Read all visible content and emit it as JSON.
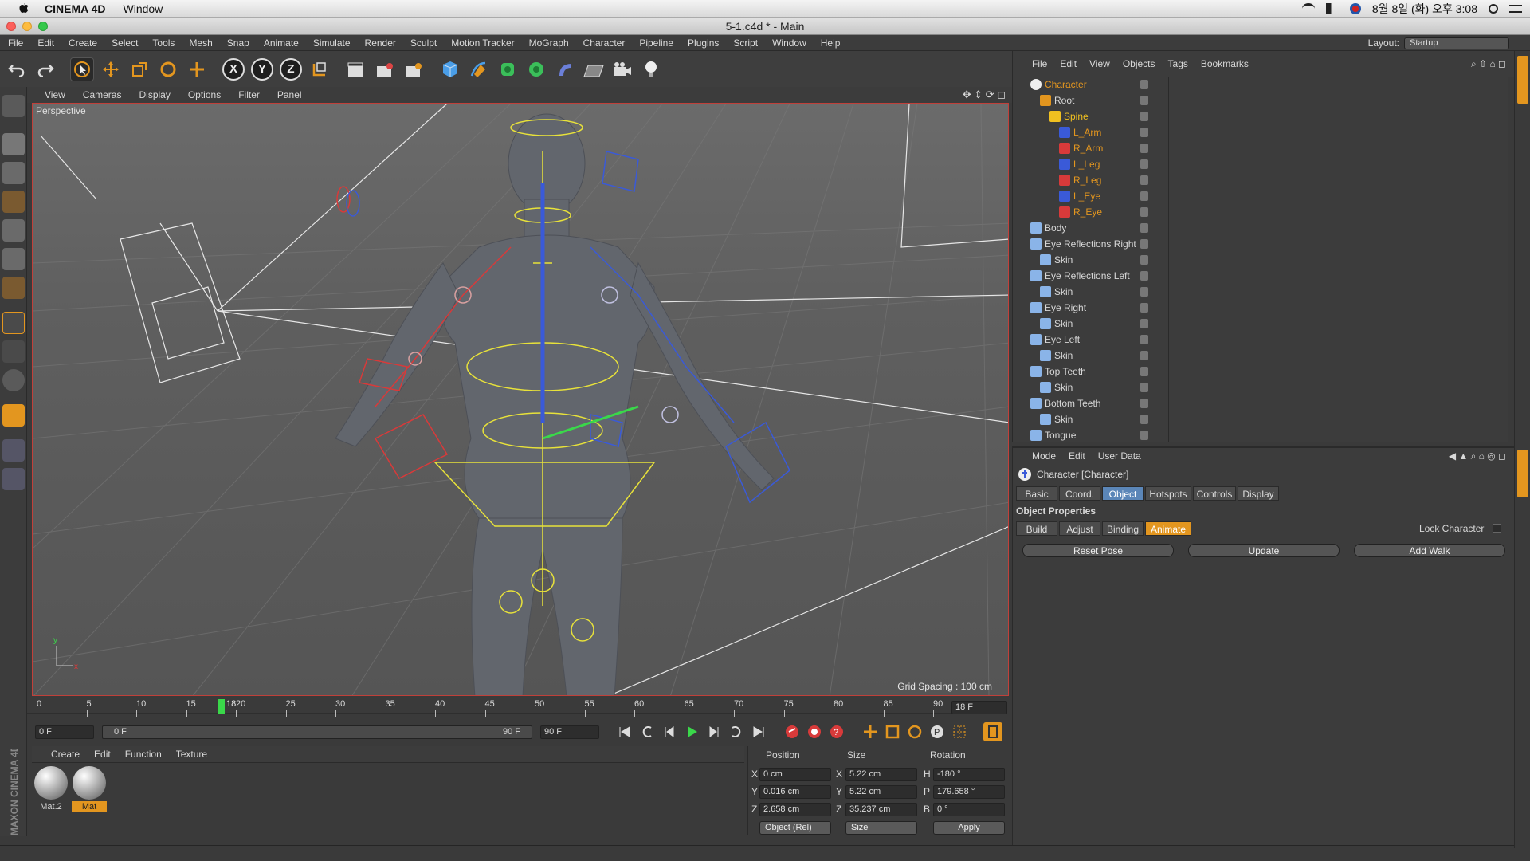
{
  "os_menubar": {
    "app_name": "CINEMA 4D",
    "menus": [
      "Window"
    ],
    "clock": "8월 8일 (화) 오후 3:08"
  },
  "window": {
    "title": "5-1.c4d * - Main"
  },
  "menu": {
    "items": [
      "File",
      "Edit",
      "Create",
      "Select",
      "Tools",
      "Mesh",
      "Snap",
      "Animate",
      "Simulate",
      "Render",
      "Sculpt",
      "Motion Tracker",
      "MoGraph",
      "Character",
      "Pipeline",
      "Plugins",
      "Script",
      "Window",
      "Help"
    ],
    "layout_label": "Layout:",
    "layout_value": "Startup"
  },
  "toolbar": {
    "axis_x": "X",
    "axis_y": "Y",
    "axis_z": "Z"
  },
  "viewport": {
    "menu": [
      "View",
      "Cameras",
      "Display",
      "Options",
      "Filter",
      "Panel"
    ],
    "label": "Perspective",
    "grid_spacing": "Grid Spacing : 100 cm"
  },
  "timeline": {
    "ticks": [
      "0",
      "5",
      "10",
      "15",
      "20",
      "25",
      "30",
      "35",
      "40",
      "45",
      "50",
      "55",
      "60",
      "65",
      "70",
      "75",
      "80",
      "85",
      "90"
    ],
    "current_frame_label": "18",
    "current_frame_field": "18 F",
    "start_field": "0 F",
    "range_start": "0 F",
    "range_end": "90 F",
    "end_field": "90 F"
  },
  "material_manager": {
    "menu": [
      "Create",
      "Edit",
      "Function",
      "Texture"
    ],
    "materials": [
      {
        "name": "Mat.2"
      },
      {
        "name": "Mat"
      }
    ],
    "brand": "MAXON CINEMA 4D"
  },
  "coordinates": {
    "headers": [
      "Position",
      "Size",
      "Rotation"
    ],
    "rows": [
      {
        "axis": "X",
        "pos": "0 cm",
        "size_axis": "X",
        "size": "5.22 cm",
        "rot_axis": "H",
        "rot": "-180 °"
      },
      {
        "axis": "Y",
        "pos": "0.016 cm",
        "size_axis": "Y",
        "size": "5.22 cm",
        "rot_axis": "P",
        "rot": "179.658 °"
      },
      {
        "axis": "Z",
        "pos": "2.658 cm",
        "size_axis": "Z",
        "size": "35.237 cm",
        "rot_axis": "B",
        "rot": "0 °"
      }
    ],
    "mode": "Object (Rel)",
    "size_mode": "Size",
    "apply": "Apply"
  },
  "object_manager": {
    "menu": [
      "File",
      "Edit",
      "View",
      "Objects",
      "Tags",
      "Bookmarks"
    ],
    "objects": [
      {
        "name": "Character",
        "color": "#e3961f"
      },
      {
        "name": "Root",
        "color": "#d8d8d8"
      },
      {
        "name": "Spine",
        "color": "#f0c020"
      },
      {
        "name": "L_Arm",
        "color": "#e3961f"
      },
      {
        "name": "R_Arm",
        "color": "#e3961f"
      },
      {
        "name": "L_Leg",
        "color": "#e3961f"
      },
      {
        "name": "R_Leg",
        "color": "#e3961f"
      },
      {
        "name": "L_Eye",
        "color": "#e3961f"
      },
      {
        "name": "R_Eye",
        "color": "#e3961f"
      },
      {
        "name": "Body",
        "color": "#d8d8d8"
      },
      {
        "name": "Eye Reflections Right",
        "color": "#d8d8d8"
      },
      {
        "name": "Skin",
        "color": "#d8d8d8"
      },
      {
        "name": "Eye Reflections Left",
        "color": "#d8d8d8"
      },
      {
        "name": "Skin",
        "color": "#d8d8d8"
      },
      {
        "name": "Eye Right",
        "color": "#d8d8d8"
      },
      {
        "name": "Skin",
        "color": "#d8d8d8"
      },
      {
        "name": "Eye Left",
        "color": "#d8d8d8"
      },
      {
        "name": "Skin",
        "color": "#d8d8d8"
      },
      {
        "name": "Top Teeth",
        "color": "#d8d8d8"
      },
      {
        "name": "Skin",
        "color": "#d8d8d8"
      },
      {
        "name": "Bottom Teeth",
        "color": "#d8d8d8"
      },
      {
        "name": "Skin",
        "color": "#d8d8d8"
      },
      {
        "name": "Tongue",
        "color": "#d8d8d8"
      }
    ]
  },
  "attribute_manager": {
    "menu": [
      "Mode",
      "Edit",
      "User Data"
    ],
    "title": "Character [Character]",
    "tabs": [
      "Basic",
      "Coord.",
      "Object",
      "Hotspots",
      "Controls",
      "Display"
    ],
    "selected_tab": "Object",
    "section": "Object Properties",
    "subtabs": [
      "Build",
      "Adjust",
      "Binding",
      "Animate"
    ],
    "selected_subtab": "Animate",
    "lock_label": "Lock Character",
    "buttons": [
      "Reset Pose",
      "Update",
      "Add Walk"
    ]
  }
}
